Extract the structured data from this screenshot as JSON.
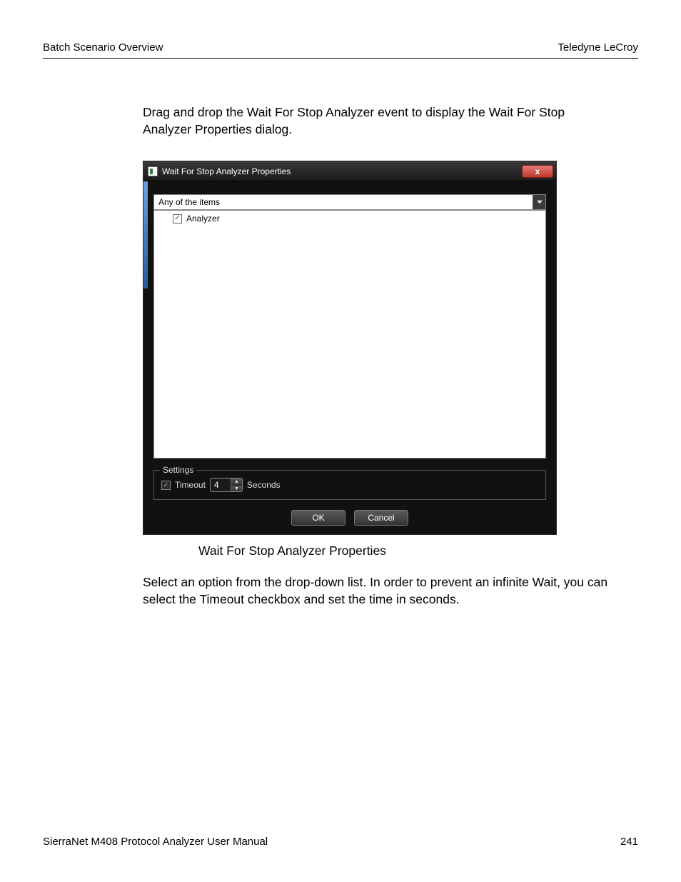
{
  "header": {
    "left": "Batch Scenario Overview",
    "right": "Teledyne LeCroy"
  },
  "para1": "Drag and drop the Wait For Stop Analyzer event to display the Wait For Stop Analyzer Properties dialog.",
  "caption": "Wait For Stop Analyzer Properties",
  "para2": "Select an option from the drop-down list. In order to prevent an infinite Wait, you can select the Timeout checkbox and set the time in seconds.",
  "footer": {
    "left": "SierraNet M408 Protocol Analyzer User Manual",
    "right": "241"
  },
  "dialog": {
    "title": "Wait For Stop Analyzer Properties",
    "close_glyph": "x",
    "combo_selected": "Any of the items",
    "list_item_label": "Analyzer",
    "list_item_checked": true,
    "settings_legend": "Settings",
    "timeout_label": "Timeout",
    "timeout_checked": true,
    "timeout_value": "4",
    "timeout_unit": "Seconds",
    "ok_label": "OK",
    "cancel_label": "Cancel"
  }
}
